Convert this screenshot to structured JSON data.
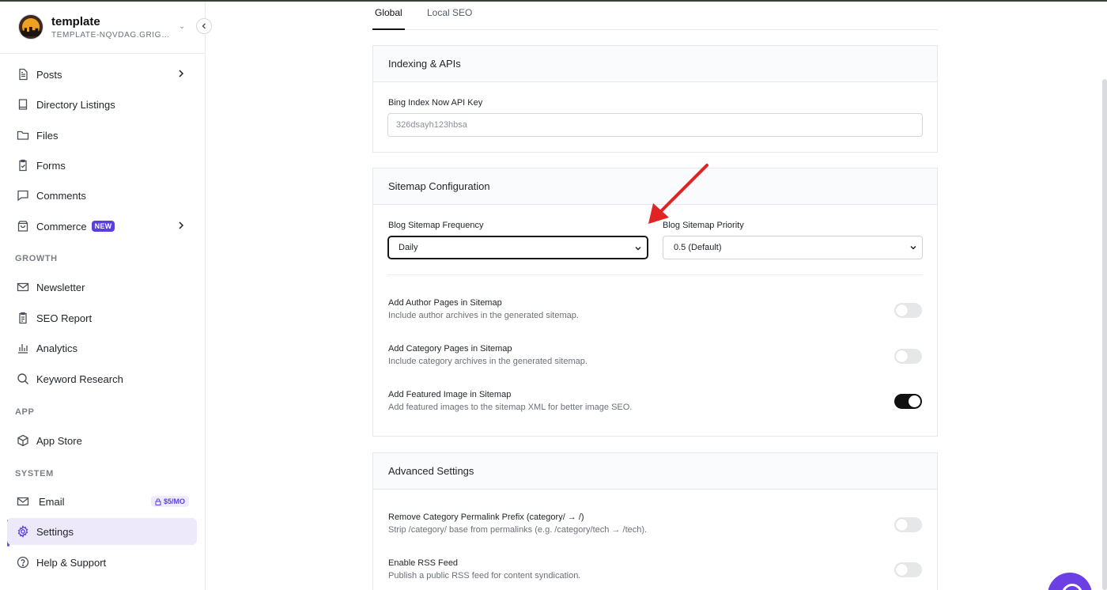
{
  "brand": {
    "name": "template",
    "domain": "TEMPLATE-NQVDAG.GRIGORE.IO"
  },
  "sidebar": {
    "items": [
      {
        "label": "Posts"
      },
      {
        "label": "Directory Listings"
      },
      {
        "label": "Files"
      },
      {
        "label": "Forms"
      },
      {
        "label": "Comments"
      },
      {
        "label": "Commerce",
        "badge": "NEW"
      }
    ],
    "growth_label": "GROWTH",
    "growth": [
      {
        "label": "Newsletter"
      },
      {
        "label": "SEO Report"
      },
      {
        "label": "Analytics"
      },
      {
        "label": "Keyword Research"
      }
    ],
    "app_label": "APP",
    "app": [
      {
        "label": "App Store"
      }
    ],
    "system_label": "SYSTEM",
    "system": [
      {
        "label": "Email",
        "badge": "$5/MO"
      },
      {
        "label": "Settings"
      },
      {
        "label": "Help & Support"
      }
    ]
  },
  "tabs": [
    {
      "label": "Global"
    },
    {
      "label": "Local SEO"
    }
  ],
  "indexing": {
    "title": "Indexing & APIs",
    "bing_label": "Bing Index Now API Key",
    "bing_value": "326dsayh123hbsa"
  },
  "sitemap": {
    "title": "Sitemap Configuration",
    "frequency_label": "Blog Sitemap Frequency",
    "frequency_value": "Daily",
    "priority_label": "Blog Sitemap Priority",
    "priority_value": "0.5 (Default)",
    "toggles": [
      {
        "title": "Add Author Pages in Sitemap",
        "desc": "Include author archives in the generated sitemap.",
        "on": false
      },
      {
        "title": "Add Category Pages in Sitemap",
        "desc": "Include category archives in the generated sitemap.",
        "on": false
      },
      {
        "title": "Add Featured Image in Sitemap",
        "desc": "Add featured images to the sitemap XML for better image SEO.",
        "on": true
      }
    ]
  },
  "advanced": {
    "title": "Advanced Settings",
    "toggles": [
      {
        "title": "Remove Category Permalink Prefix (category/ → /)",
        "desc": "Strip /category/ base from permalinks (e.g. /category/tech → /tech).",
        "on": false
      },
      {
        "title": "Enable RSS Feed",
        "desc": "Publish a public RSS feed for content syndication.",
        "on": false
      }
    ]
  },
  "colors": {
    "accent": "#6b4ee6",
    "arrow": "#e02424",
    "toggle_on": "#111111"
  }
}
